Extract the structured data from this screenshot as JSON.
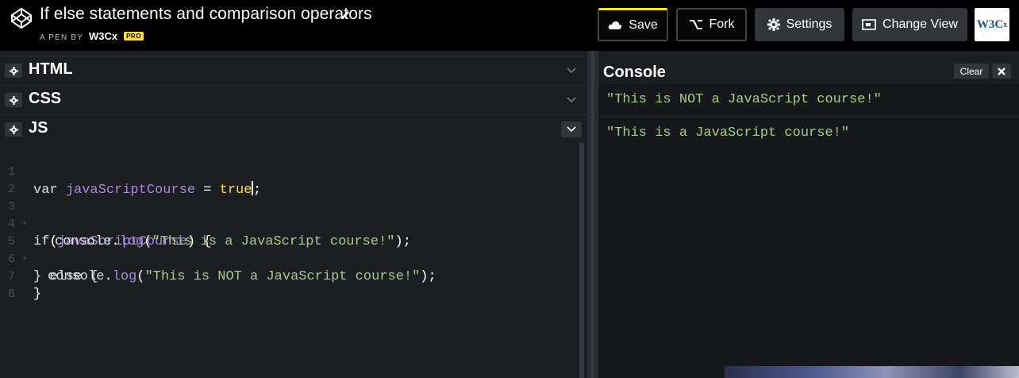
{
  "header": {
    "title": "If else statements and comparison operators",
    "byline_prefix": "A PEN BY",
    "author": "W3Cx",
    "badge": "PRO",
    "buttons": {
      "save": "Save",
      "fork": "Fork",
      "settings": "Settings",
      "change_view": "Change View"
    },
    "brand_logo": "W3C",
    "brand_suffix": "x"
  },
  "panes": {
    "html": "HTML",
    "css": "CSS",
    "js": "JS"
  },
  "code": {
    "lines": [
      {
        "n": "1"
      },
      {
        "n": "2"
      },
      {
        "n": "3"
      },
      {
        "n": "4"
      },
      {
        "n": "5"
      },
      {
        "n": "6"
      },
      {
        "n": "7"
      },
      {
        "n": "8"
      }
    ],
    "tokens": {
      "var_kw": "var",
      "var_name": "javaScriptCourse",
      "eq": " = ",
      "true_val": "true",
      "semi": ";",
      "if_kw": "if",
      "if_open": "(",
      "if_cond": "javaScriptCourse",
      "if_close": ") {",
      "console1": "console",
      "dot1": ".",
      "log1": "log",
      "paren1_open": "(",
      "str1": "\"This is a JavaScript course!\"",
      "paren1_close": ");",
      "else_line": "} else {",
      "console2": "console",
      "dot2": ".",
      "log2": "log",
      "paren2_open": "(",
      "str2": "\"This is NOT a JavaScript course!\"",
      "paren2_close": ");",
      "close_brace": "}"
    }
  },
  "console": {
    "title": "Console",
    "clear_label": "Clear",
    "logs": [
      "\"This is NOT a JavaScript course!\"",
      "\"This is a JavaScript course!\""
    ]
  },
  "colors": {
    "accent_save": "#47cf73",
    "accent_yellow": "#ffdd40",
    "string": "#a5cd8b",
    "identifier": "#a88adf"
  }
}
